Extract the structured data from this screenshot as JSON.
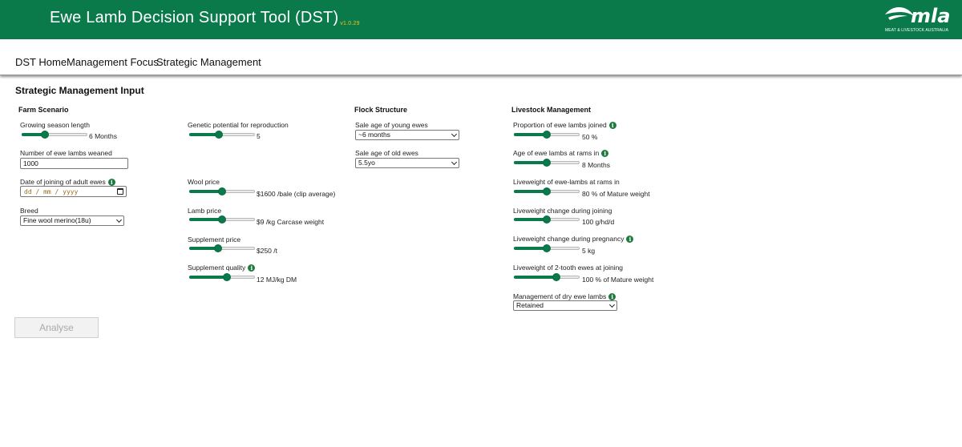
{
  "header": {
    "title": "Ewe Lamb Decision Support Tool (DST)",
    "version": "v1.0.29",
    "logo_text": "mla",
    "logo_subtext": "MEAT & LIVESTOCK AUSTRALIA",
    "bg_color": "#0a7a4b"
  },
  "nav": {
    "items": [
      "DST Home",
      "Management Focus",
      "Strategic Management"
    ]
  },
  "page": {
    "heading": "Strategic Management Input"
  },
  "farm": {
    "title": "Farm Scenario",
    "growing_season": {
      "label": "Growing season length",
      "level": 0.33,
      "value": "6 Months"
    },
    "ewe_lambs_weaned": {
      "label": "Number of ewe lambs weaned",
      "value": "1000"
    },
    "joining_date": {
      "label": "Date of joining of adult ewes",
      "placeholder": "dd / mm / yyyy",
      "icon": "info-icon"
    },
    "breed": {
      "label": "Breed",
      "value": "Fine wool merino(18u)"
    }
  },
  "economics": {
    "genetic_potential": {
      "label": "Genetic potential for reproduction",
      "level": 0.45,
      "value": "5"
    },
    "wool_price": {
      "label": "Wool price",
      "level": 0.5,
      "value": "$1600 /bale (clip average)"
    },
    "lamb_price": {
      "label": "Lamb price",
      "level": 0.5,
      "value": "$9 /kg Carcase weight"
    },
    "supplement_price": {
      "label": "Supplement price",
      "level": 0.43,
      "value": "$250 /t"
    },
    "supplement_quality": {
      "label": "Supplement quality",
      "level": 0.58,
      "value": "12 MJ/kg DM",
      "icon": "info-icon"
    }
  },
  "flock": {
    "title": "Flock Structure",
    "young_ewes": {
      "label": "Sale age of young ewes",
      "value": "~6 months"
    },
    "old_ewes": {
      "label": "Sale age of old ewes",
      "value": "5.5yo"
    }
  },
  "livestock": {
    "title": "Livestock Management",
    "proportion_joined": {
      "label": "Proportion of ewe lambs joined",
      "level": 0.5,
      "value": "50 %",
      "icon": "info-icon"
    },
    "age_at_rams": {
      "label": "Age of ewe lambs at rams in",
      "level": 0.5,
      "value": "8 Months",
      "icon": "info-icon"
    },
    "liveweight_at_rams": {
      "label": "Liveweight of ewe-lambs at rams in",
      "level": 0.5,
      "value": "80 % of Mature weight"
    },
    "lw_change_joining": {
      "label": "Liveweight change during joining",
      "level": 0.5,
      "value": "100 g/hd/d"
    },
    "lw_change_pregnancy": {
      "label": "Liveweight change during pregnancy",
      "level": 0.5,
      "value": "5 kg",
      "icon": "info-icon"
    },
    "lw_two_tooth": {
      "label": "Liveweight of 2-tooth ewes at joining",
      "level": 0.67,
      "value": "100 % of Mature weight"
    },
    "dry_ewe_lambs": {
      "label": "Management of dry ewe lambs",
      "value": "Retained",
      "icon": "info-icon"
    }
  },
  "actions": {
    "analyse_label": "Analyse"
  }
}
